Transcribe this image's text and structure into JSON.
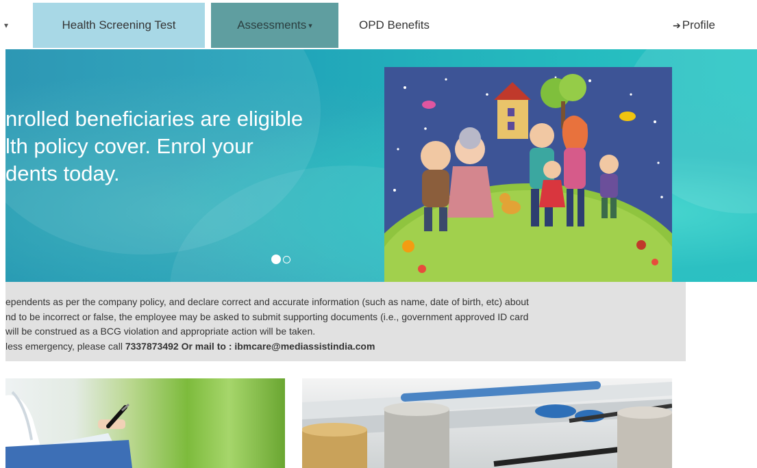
{
  "nav": {
    "left_caret": "▾",
    "items": [
      {
        "label": "Health Screening Test"
      },
      {
        "label": "Assessments",
        "caret": "▾"
      },
      {
        "label": "OPD Benefits"
      }
    ],
    "profile": {
      "icon": "sign-in-icon",
      "label": "Profile"
    },
    "colors": {
      "health_screening_bg": "#a8d8e6",
      "assessments_bg": "#5f9ea0"
    }
  },
  "banner": {
    "headline_lines": [
      "nrolled beneficiaries are eligible",
      "lth policy cover. Enrol your",
      "dents today."
    ],
    "slides_total": 2,
    "active_slide": 1,
    "illustration": "family-on-hill-illustration",
    "colors": {
      "gradient_start": "#1c8fae",
      "gradient_end": "#28c6c4"
    }
  },
  "notice": {
    "lines": [
      "ependents as per the company policy, and declare correct and accurate information (such as name, date of birth, etc) about",
      "nd to be incorrect or false, the employee may be asked to submit supporting documents (i.e., government approved ID card",
      " will be construed as a BCG violation and appropriate action will be taken."
    ],
    "contact_prefix": "less emergency, please call ",
    "contact_bold": "7337873492 Or mail to : ibmcare@mediassistindia.com"
  },
  "cards": [
    {
      "image": "doctor-clipboard-photo"
    },
    {
      "image": "coins-and-pens-photo"
    }
  ]
}
